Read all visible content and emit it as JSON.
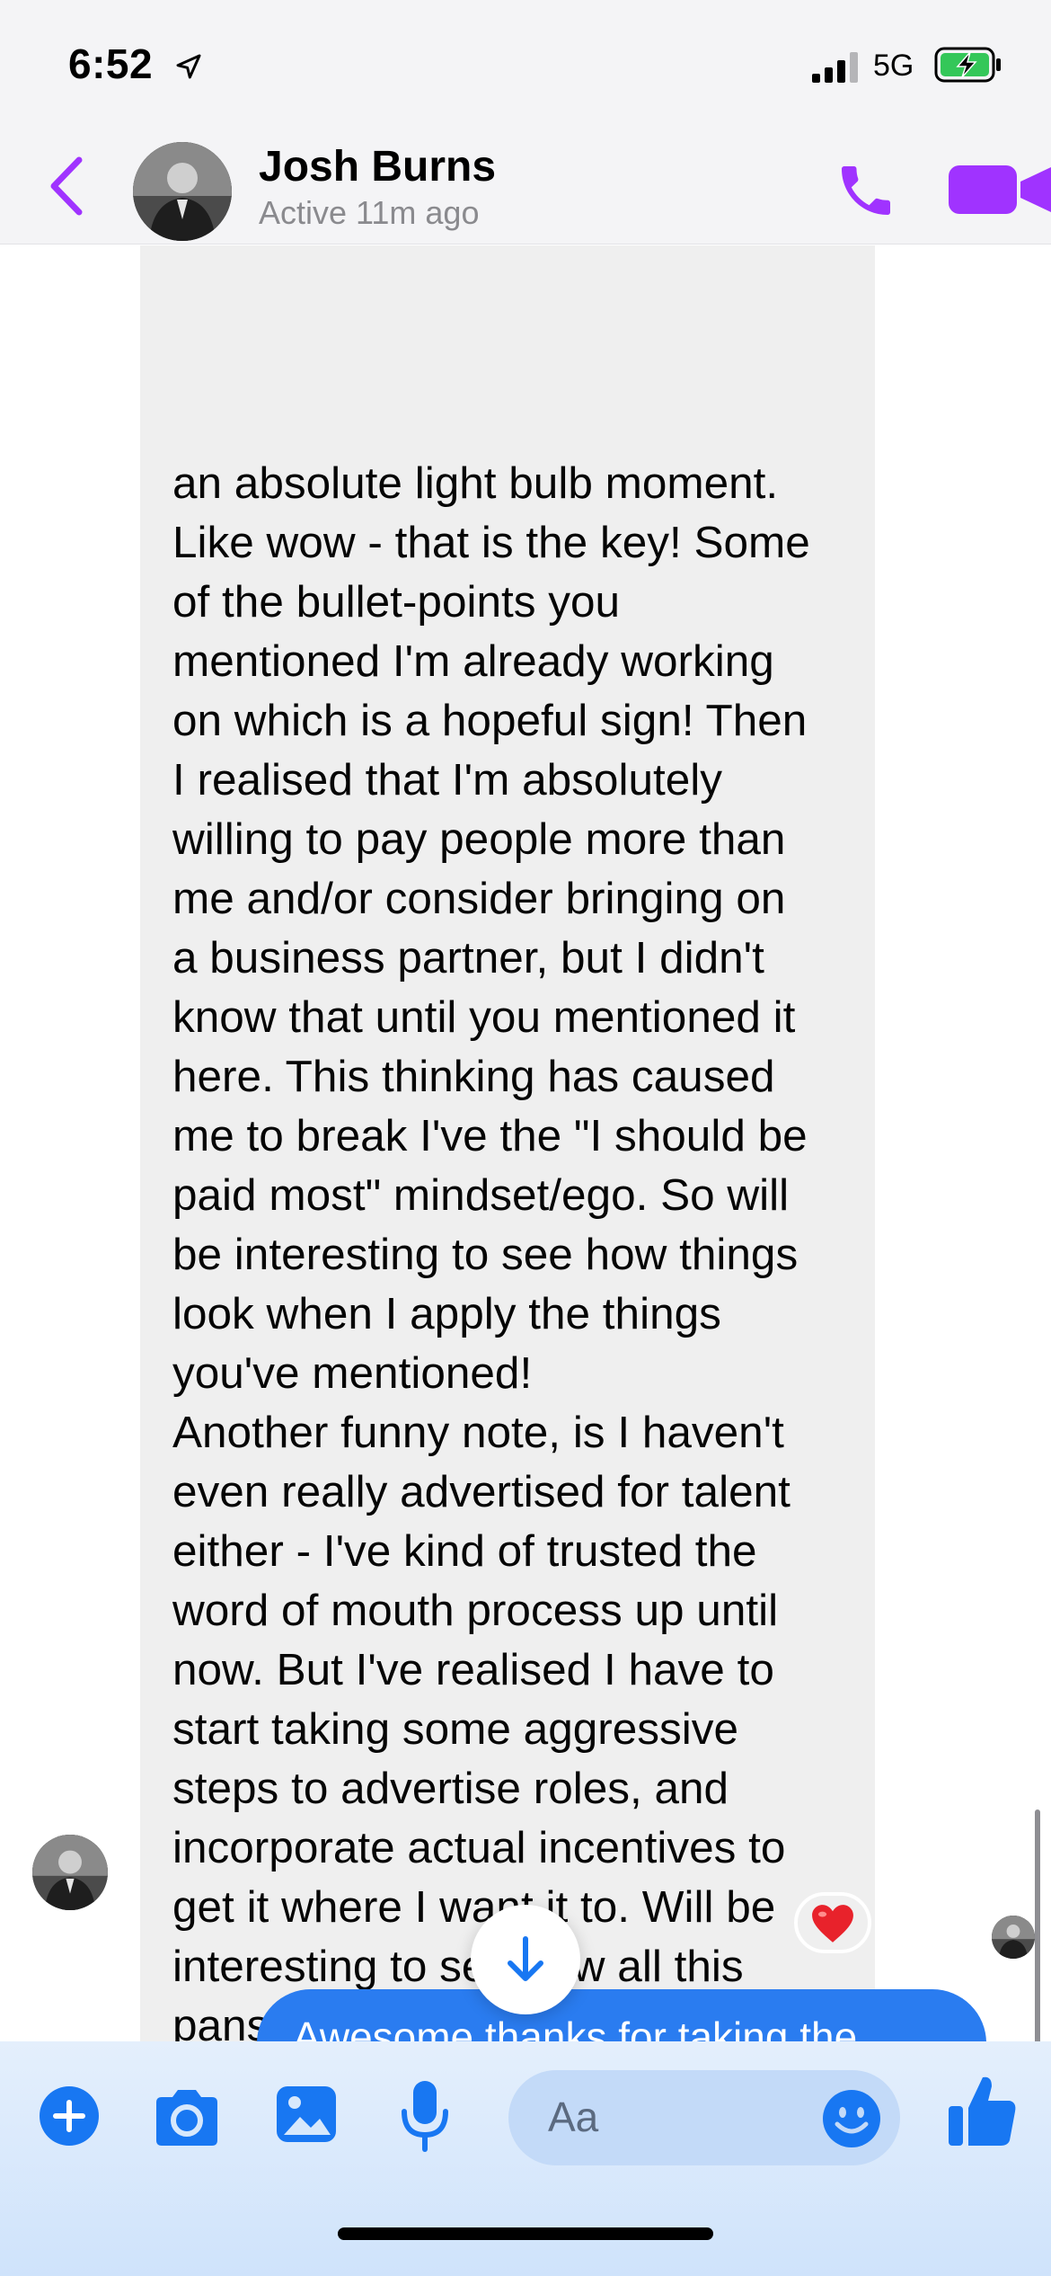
{
  "status_bar": {
    "time": "6:52",
    "network": "5G",
    "battery_charging": true
  },
  "header": {
    "contact_name": "Josh Burns",
    "contact_status": "Active 11m ago",
    "accent_color": "#a033ff"
  },
  "messages": {
    "incoming_text": "an absolute light bulb moment.\nLike wow - that is the key! Some\nof the bullet-points you\nmentioned I'm already working\non which is a hopeful sign! Then\nI realised that I'm absolutely\nwilling to pay people more than\nme and/or consider bringing on\na business partner, but I didn't\nknow that until you mentioned it\nhere. This thinking has caused\nme to break I've the \"I should be\npaid most\" mindset/ego. So will\nbe interesting to see how things\nlook when I apply the things\nyou've mentioned!\nAnother funny note, is I haven't\neven really advertised for talent\neither - I've kind of trusted the\nword of mouth process up until\nnow. But I've realised I have to\nstart taking some aggressive\nsteps to advertise roles, and\nincorporate actual incentives to\nget it where I want it to. Will be\ninteresting to see how all this\npans out. Once again, thank you\nfor sharing your wisdom!",
    "reaction": "❤️",
    "outgoing_text": "Awesome thanks for taking the",
    "outgoing_color": "#2a7cf0"
  },
  "composer": {
    "placeholder": "Aa",
    "accent_color": "#1877f2"
  }
}
